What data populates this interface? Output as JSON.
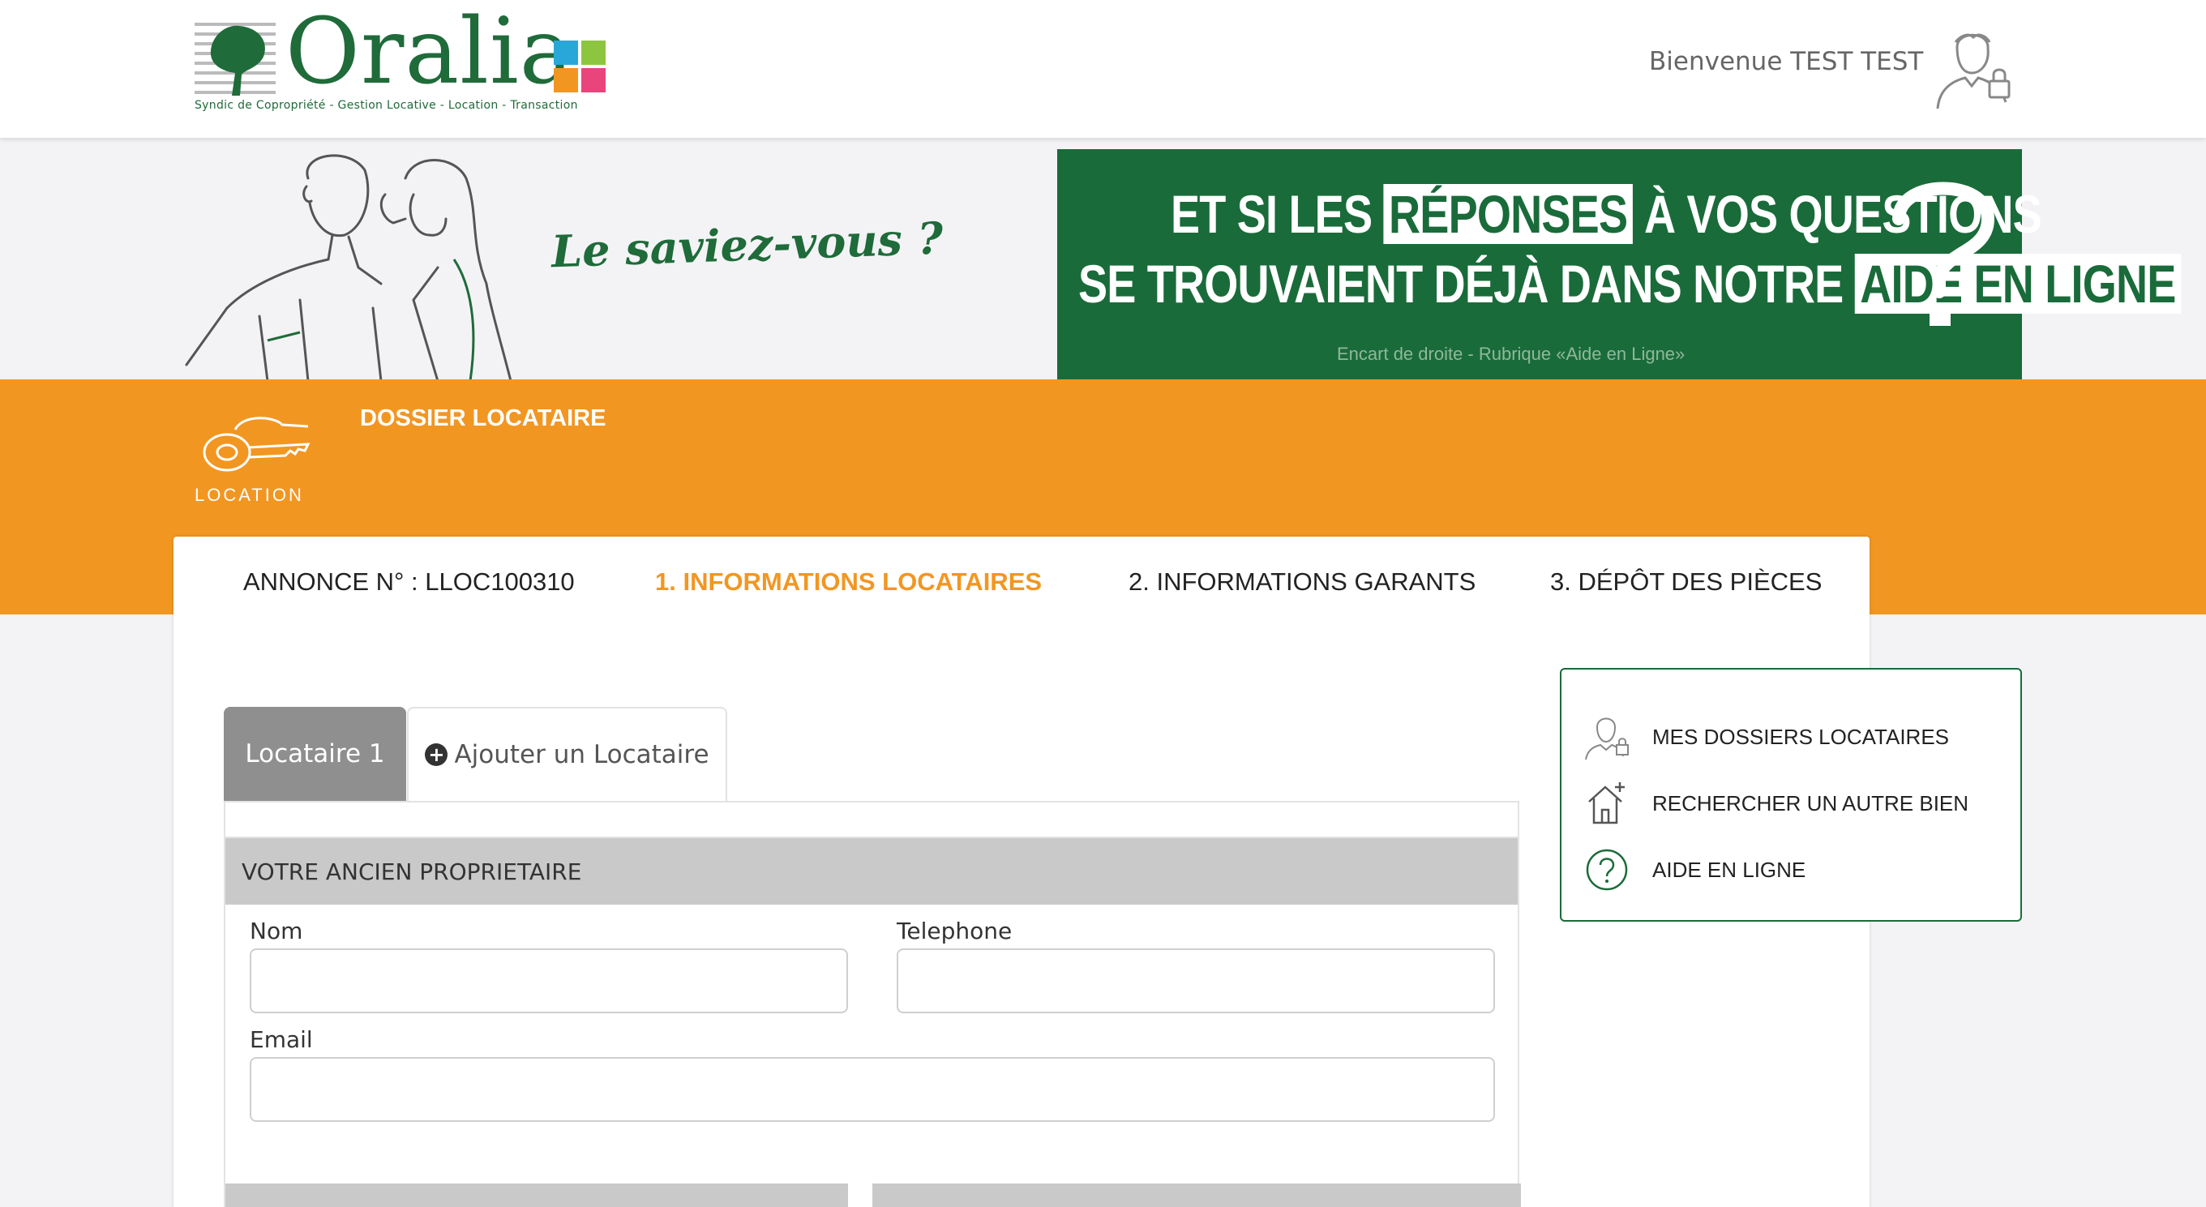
{
  "header": {
    "logo_word": "Oralia",
    "logo_tagline": "Syndic de Copropriété - Gestion Locative - Location - Transaction",
    "welcome": "Bienvenue TEST TEST"
  },
  "banner": {
    "left_text": "Le saviez-vous ?",
    "line1_a": "ET SI LES",
    "line1_hl": "RÉPONSES",
    "line1_b": "À VOS QUESTIONS",
    "line2_a": "SE TROUVAIENT DÉJÀ DANS NOTRE",
    "line2_hl": "AIDE EN LIGNE",
    "caption": "Encart de droite - Rubrique «Aide en Ligne»"
  },
  "section": {
    "icon_label": "LOCATION",
    "title": "DOSSIER LOCATAIRE"
  },
  "steps": {
    "annonce": "ANNONCE N° : LLOC100310",
    "step1": "1. INFORMATIONS LOCATAIRES",
    "step2": "2. INFORMATIONS GARANTS",
    "step3": "3. DÉPÔT DES PIÈCES"
  },
  "tabs": {
    "tenant1": "Locataire 1",
    "add_tenant": "Ajouter un Locataire"
  },
  "form": {
    "section_title": "VOTRE ANCIEN PROPRIETAIRE",
    "nom_label": "Nom",
    "telephone_label": "Telephone",
    "email_label": "Email"
  },
  "sidebar": {
    "items": [
      {
        "label": "MES DOSSIERS LOCATAIRES",
        "icon": "user-lock-icon"
      },
      {
        "label": "RECHERCHER UN AUTRE BIEN",
        "icon": "house-plus-icon"
      },
      {
        "label": "AIDE EN LIGNE",
        "icon": "question-circle-icon"
      }
    ]
  },
  "colors": {
    "brand_green": "#1a6b3a",
    "accent_orange": "#f29622"
  }
}
